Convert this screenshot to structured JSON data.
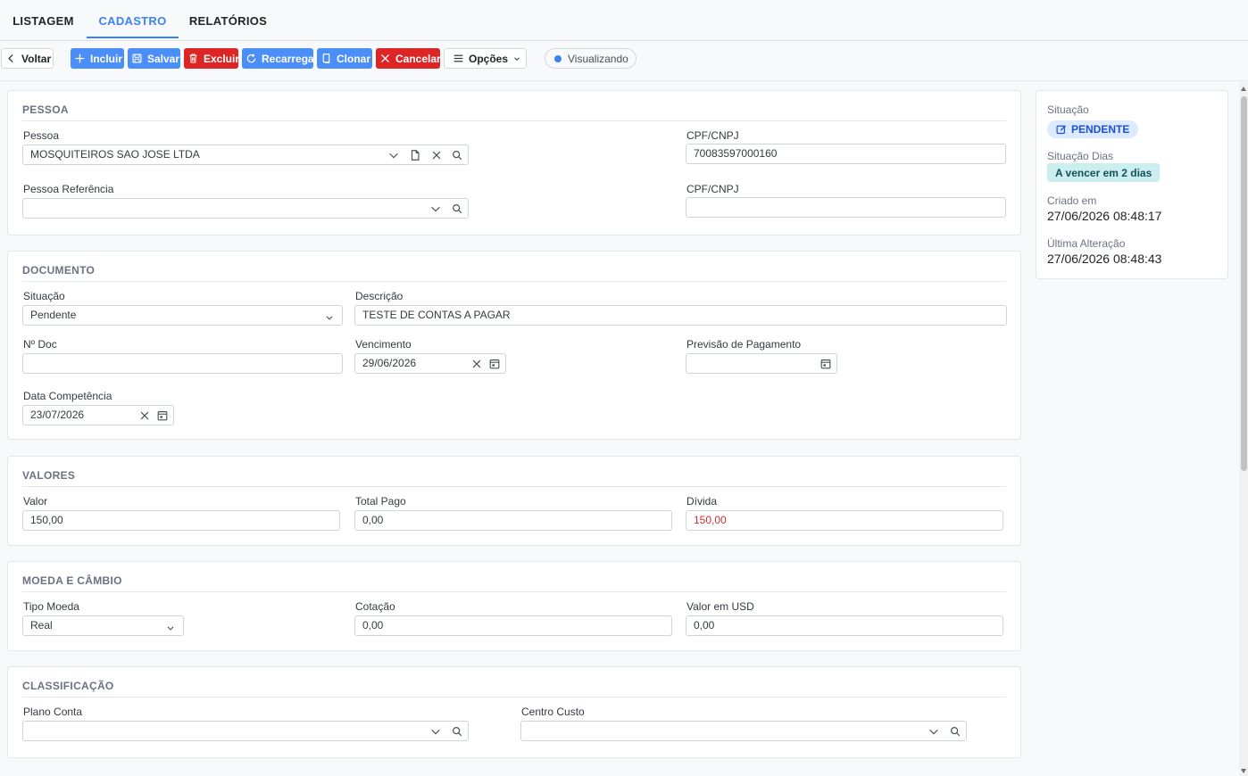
{
  "tabs": [
    "LISTAGEM",
    "CADASTRO",
    "RELATÓRIOS"
  ],
  "toolbar": {
    "voltar": "Voltar",
    "incluir": "Incluir",
    "salvar": "Salvar",
    "excluir": "Excluir",
    "recarrega": "Recarrega",
    "clonar": "Clonar",
    "cancelar": "Cancelar",
    "opcoes": "Opções",
    "status": "Visualizando"
  },
  "pessoa": {
    "title": "PESSOA",
    "pessoa_label": "Pessoa",
    "pessoa_value": "MOSQUITEIROS SAO JOSE LTDA",
    "cpf_label": "CPF/CNPJ",
    "cpf_value": "70083597000160",
    "ref_label": "Pessoa Referência",
    "ref_value": "",
    "cpf2_label": "CPF/CNPJ",
    "cpf2_value": ""
  },
  "documento": {
    "title": "DOCUMENTO",
    "situacao_label": "Situação",
    "situacao_value": "Pendente",
    "descricao_label": "Descrição",
    "descricao_value": "TESTE DE CONTAS A PAGAR",
    "ndoc_label": "Nº Doc",
    "ndoc_value": "",
    "vencimento_label": "Vencimento",
    "vencimento_value": "29/06/2026",
    "previsao_label": "Previsão de Pagamento",
    "previsao_value": "",
    "competencia_label": "Data Competência",
    "competencia_value": "23/07/2026"
  },
  "valores": {
    "title": "VALORES",
    "valor_label": "Valor",
    "valor_value": "150,00",
    "pago_label": "Total Pago",
    "pago_value": "0,00",
    "divida_label": "Dívida",
    "divida_value": "150,00"
  },
  "moeda": {
    "title": "MOEDA E CÂMBIO",
    "tipo_label": "Tipo Moeda",
    "tipo_value": "Real",
    "cotacao_label": "Cotação",
    "cotacao_value": "0,00",
    "usd_label": "Valor em USD",
    "usd_value": "0,00"
  },
  "classificacao": {
    "title": "CLASSIFICAÇÃO",
    "plano_label": "Plano Conta",
    "plano_value": "",
    "centro_label": "Centro Custo",
    "centro_value": ""
  },
  "side": {
    "situacao_label": "Situação",
    "situacao_badge": "PENDENTE",
    "dias_label": "Situação Dias",
    "dias_badge": "A vencer em 2 dias",
    "criado_label": "Criado em",
    "criado_value": "27/06/2026 08:48:17",
    "alter_label": "Última Alteração",
    "alter_value": "27/06/2026 08:48:43"
  },
  "colors": {
    "primary": "#4c8ef7",
    "danger": "#dc2626",
    "tab_active": "#3b82f6",
    "debt_text": "#d0312d"
  }
}
